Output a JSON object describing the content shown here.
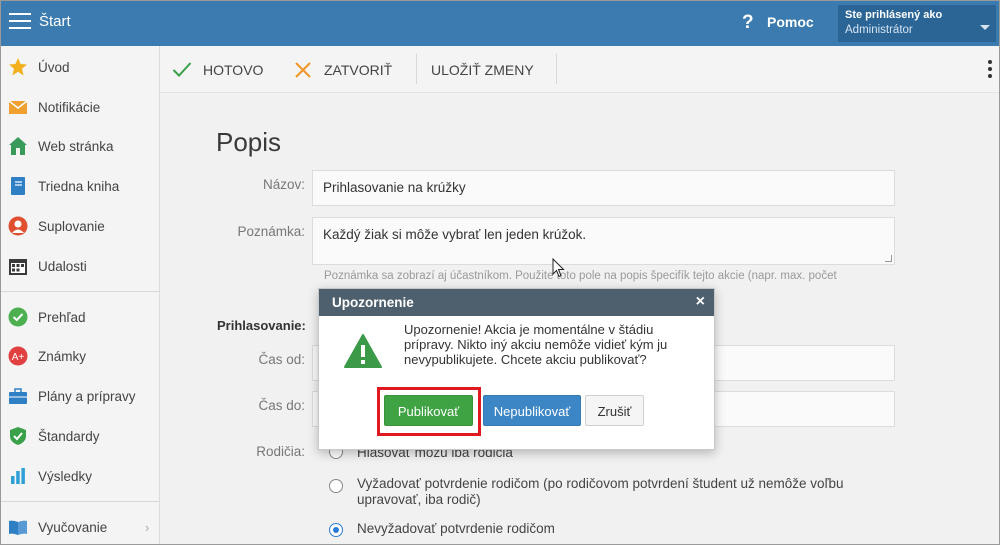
{
  "topbar": {
    "title": "Štart",
    "help_icon": "question-mark-icon",
    "help_label": "Pomoc",
    "user_line1": "Ste prihlásený ako",
    "user_line2": "Administrátor"
  },
  "sidebar": {
    "items": [
      {
        "label": "Úvod",
        "icon": "star-icon",
        "color": "#f2b01e"
      },
      {
        "label": "Notifikácie",
        "icon": "envelope-icon",
        "color": "#f0a030"
      },
      {
        "label": "Web stránka",
        "icon": "house-icon",
        "color": "#3a9a5a"
      },
      {
        "label": "Triedna kniha",
        "icon": "book-icon",
        "color": "#2f7fc4"
      },
      {
        "label": "Suplovanie",
        "icon": "person-icon",
        "color": "#e05030"
      },
      {
        "label": "Udalosti",
        "icon": "calendar-icon",
        "color": "#3a3a3a"
      },
      {
        "label": "Prehľad",
        "icon": "check-circle-icon",
        "color": "#4cb050"
      },
      {
        "label": "Známky",
        "icon": "grade-icon",
        "color": "#e04040"
      },
      {
        "label": "Plány a prípravy",
        "icon": "briefcase-icon",
        "color": "#2f7fc4"
      },
      {
        "label": "Štandardy",
        "icon": "shield-icon",
        "color": "#3aa04a"
      },
      {
        "label": "Výsledky",
        "icon": "bar-chart-icon",
        "color": "#2f9fd8"
      },
      {
        "label": "Vyučovanie",
        "icon": "open-book-icon",
        "color": "#2f7fc4"
      }
    ]
  },
  "toolbar": {
    "done_label": "HOTOVO",
    "close_label": "ZATVORIŤ",
    "save_label": "ULOŽIŤ ZMENY"
  },
  "form": {
    "heading": "Popis",
    "name_label": "Názov:",
    "name_value": "Prihlasovanie na krúžky",
    "note_label": "Poznámka:",
    "note_value": "Každý žiak si môže vybrať len jeden krúžok.",
    "note_hint": "Poznámka sa zobrazí aj účastníkom. Použite toto pole na popis špecifík tejto akcie (napr. max. počet",
    "registration_title": "Prihlasovanie:",
    "time_from_label": "Čas od:",
    "time_to_label": "Čas do:",
    "parents_label": "Rodičia:",
    "parents_options": [
      {
        "label": "Hlasovať môžu iba rodičia",
        "checked": false
      },
      {
        "label": "Vyžadovať potvrdenie rodičom (po rodičovom potvrdení študent už nemôže voľbu upravovať, iba rodič)",
        "checked": false
      },
      {
        "label": "Nevyžadovať potvrdenie rodičom",
        "checked": true
      }
    ]
  },
  "modal": {
    "title": "Upozornenie",
    "close_symbol": "×",
    "message": "Upozornenie! Akcia je momentálne v štádiu prípravy. Nikto iný akciu nemôže vidieť kým ju nevypublikujete. Chcete akciu publikovať?",
    "publish_label": "Publikovať",
    "unpublish_label": "Nepublikovať",
    "cancel_label": "Zrušiť"
  },
  "colors": {
    "topbar": "#3b7bb0",
    "publish": "#3fa243",
    "unpublish": "#3d86c6",
    "highlight": "#e0181f",
    "modal_header": "#4e5f6d"
  }
}
